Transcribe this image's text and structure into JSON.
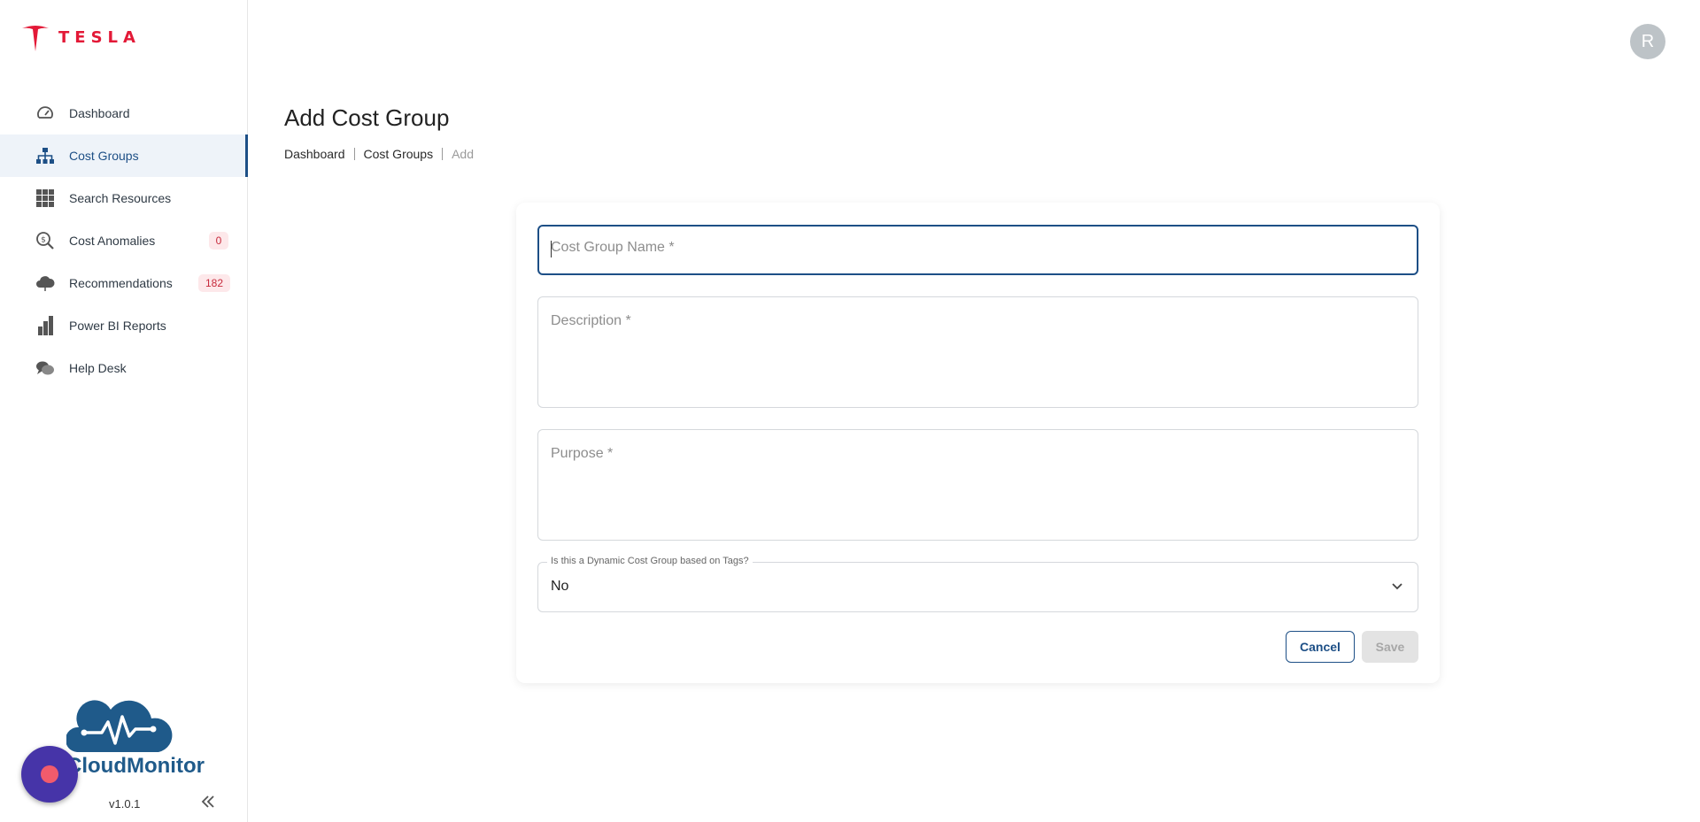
{
  "logo": {
    "text": "TESLA",
    "brand_color": "#e31937"
  },
  "sidebar": {
    "items": [
      {
        "label": "Dashboard",
        "icon": "dashboard-gauge-icon"
      },
      {
        "label": "Cost Groups",
        "icon": "hierarchy-icon",
        "active": true
      },
      {
        "label": "Search Resources",
        "icon": "grid-icon"
      },
      {
        "label": "Cost Anomalies",
        "icon": "dollar-search-icon",
        "badge": "0"
      },
      {
        "label": "Recommendations",
        "icon": "cloud-icon",
        "badge": "182"
      },
      {
        "label": "Power BI Reports",
        "icon": "bar-chart-icon"
      },
      {
        "label": "Help Desk",
        "icon": "chat-bubbles-icon"
      }
    ],
    "brand": "CloudMonitor",
    "version": "v1.0.1",
    "accent": "#1d4f86"
  },
  "header": {
    "avatar_initial": "R"
  },
  "page": {
    "title": "Add Cost Group",
    "breadcrumb": [
      "Dashboard",
      "Cost Groups",
      "Add"
    ]
  },
  "form": {
    "name_placeholder": "Cost Group Name *",
    "description_placeholder": "Description *",
    "purpose_placeholder": "Purpose *",
    "dynamic_label": "Is this a Dynamic Cost Group based on Tags?",
    "dynamic_value": "No",
    "cancel_label": "Cancel",
    "save_label": "Save"
  }
}
